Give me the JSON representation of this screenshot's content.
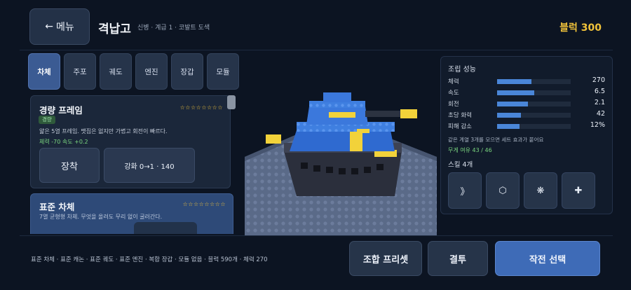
{
  "header": {
    "back_label": "메뉴",
    "back_icon": "arrow-left-icon",
    "title": "격납고",
    "subtitle": "신병 · 계급 1 · 코발트 도색",
    "currency": "블럭 300"
  },
  "tabs": [
    {
      "label": "차체",
      "active": true
    },
    {
      "label": "주포"
    },
    {
      "label": "궤도"
    },
    {
      "label": "엔진"
    },
    {
      "label": "장갑"
    },
    {
      "label": "모듈"
    }
  ],
  "parts": [
    {
      "name": "경량 프레임",
      "stars": "☆☆☆☆☆☆☆☆",
      "badge": "경량",
      "desc": "얇은 5열 프레임. 맷집은 없지만 가볍고 회전이 빠르다.",
      "stats": "체력 -70  속도 +0.2",
      "equip_label": "장착",
      "upgrade_label": "강화 0→1 · 140"
    },
    {
      "name": "표준 차체",
      "stars": "☆☆☆☆☆☆☆☆",
      "desc": "7열 균형형 차체. 무엇을 올려도 무리 없이 굴러간다."
    }
  ],
  "stats": {
    "title": "조립 성능",
    "rows": [
      {
        "label": "체력",
        "value": "270",
        "fill": 0.47
      },
      {
        "label": "속도",
        "value": "6.5",
        "fill": 0.5
      },
      {
        "label": "회전",
        "value": "2.1",
        "fill": 0.42
      },
      {
        "label": "초당 화력",
        "value": "42",
        "fill": 0.32
      },
      {
        "label": "피해 감소",
        "value": "12%",
        "fill": 0.3
      }
    ],
    "set_note": "같은 계열 3개를 모으면 세트 효과가 붙어요",
    "weight": "무게 여유 43 / 46",
    "skill_title": "스킬 4개",
    "skills": [
      {
        "icon": "double-chevron-icon",
        "glyph": "》"
      },
      {
        "icon": "hexagon-icon",
        "glyph": "⬡"
      },
      {
        "icon": "burst-icon",
        "glyph": "❋"
      },
      {
        "icon": "plus-icon",
        "glyph": "✚"
      }
    ]
  },
  "bottom": {
    "loadout": "표준 차체 · 표준 캐논 · 표준 궤도 · 표준 엔진 · 복합 장갑 · 모듈 없음  ·  블럭 590개  ·  체력 270",
    "preset_label": "조합 프리셋",
    "duel_label": "결투",
    "mission_label": "작전 선택"
  },
  "colors": {
    "accent": "#3e6bb7",
    "currency": "#f0c23a",
    "positive": "#7ad67f",
    "tank_blue": "#3f7fe0",
    "tank_yellow": "#f2d23a"
  }
}
